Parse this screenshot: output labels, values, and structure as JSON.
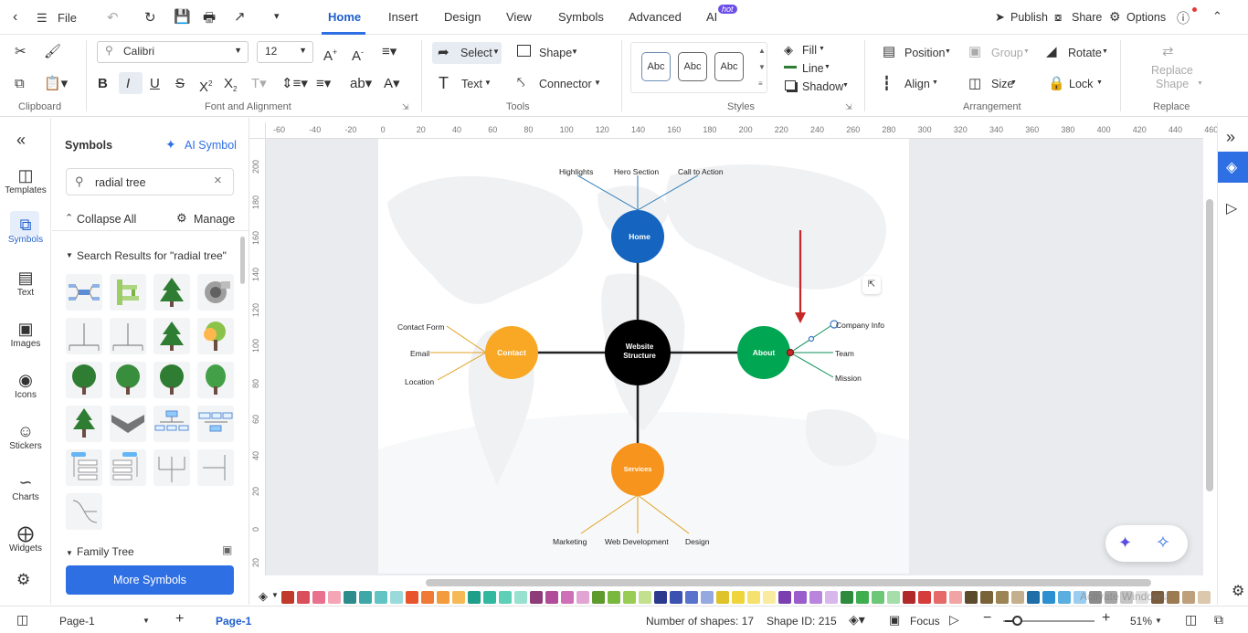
{
  "topbar": {
    "file": "File",
    "tabs": [
      "Home",
      "Insert",
      "Design",
      "View",
      "Symbols",
      "Advanced",
      "AI"
    ],
    "ai_badge": "hot",
    "publish": "Publish",
    "share": "Share",
    "options": "Options"
  },
  "ribbon": {
    "clipboard_label": "Clipboard",
    "font_label": "Font and Alignment",
    "tools_label": "Tools",
    "styles_label": "Styles",
    "arrangement_label": "Arrangement",
    "replace_label": "Replace",
    "font_name": "Calibri",
    "font_size": "12",
    "select": "Select",
    "shape": "Shape",
    "text": "Text",
    "connector": "Connector",
    "style_sample": "Abc",
    "fill": "Fill",
    "line": "Line",
    "shadow": "Shadow",
    "position": "Position",
    "group": "Group",
    "rotate": "Rotate",
    "align": "Align",
    "size": "Size",
    "lock": "Lock",
    "replace_shape_1": "Replace",
    "replace_shape_2": "Shape"
  },
  "rail": {
    "items": [
      "Templates",
      "Symbols",
      "Text",
      "Images",
      "Icons",
      "Stickers",
      "Charts",
      "Widgets"
    ]
  },
  "symbols_panel": {
    "title": "Symbols",
    "ai_symbol": "AI Symbol",
    "search_value": "radial tree",
    "collapse_all": "Collapse All",
    "manage": "Manage",
    "results_header": "Search Results for  \"radial tree\"",
    "family_tree": "Family Tree",
    "more_symbols": "More Symbols"
  },
  "ruler": {
    "h": [
      "-60",
      "-40",
      "-20",
      "0",
      "20",
      "40",
      "60",
      "80",
      "100",
      "120",
      "140",
      "160",
      "180",
      "200",
      "220",
      "240",
      "260",
      "280",
      "300",
      "320",
      "340",
      "360",
      "380",
      "400",
      "420",
      "440",
      "460"
    ],
    "v": [
      "200",
      "180",
      "160",
      "140",
      "120",
      "100",
      "80",
      "60",
      "40",
      "20",
      "0",
      "20"
    ]
  },
  "diagram": {
    "center": "Website Structure",
    "center_l1": "Website",
    "center_l2": "Structure",
    "home": "Home",
    "contact": "Contact",
    "about": "About",
    "services": "Services",
    "home_children": [
      "Highlights",
      "Hero Section",
      "Call to Action"
    ],
    "contact_children": [
      "Contact Form",
      "Email",
      "Location"
    ],
    "about_children": [
      "Company Info",
      "Team",
      "Mission"
    ],
    "services_children": [
      "Marketing",
      "Web Development",
      "Design"
    ],
    "colors": {
      "home": "#1565c0",
      "contact": "#f9a825",
      "about": "#00a651",
      "services": "#f7941d",
      "center": "#000000",
      "line_home": "#2a7ab5",
      "line_contact": "#e0a020",
      "line_about": "#0b8f5a",
      "line_services": "#e0a020",
      "arrow": "#c62828"
    }
  },
  "palette": [
    "#c0392b",
    "#d94f5c",
    "#e8718d",
    "#f4a6b7",
    "#2e8b8b",
    "#3fa7a7",
    "#62c4c4",
    "#9bdada",
    "#e8552c",
    "#f07a35",
    "#f39c3e",
    "#f7b955",
    "#1f9e89",
    "#33b8a0",
    "#5fcfb7",
    "#98e0cf",
    "#8e3b7a",
    "#b04c98",
    "#cf6fb8",
    "#e2a5d3",
    "#5e9a2c",
    "#78b83c",
    "#99cc55",
    "#c2e08e",
    "#2b3a8c",
    "#3c52b0",
    "#5a73cc",
    "#96a8e0",
    "#e0c22a",
    "#f0d43c",
    "#f5e16e",
    "#f9ec9f",
    "#7b3fb0",
    "#9b5ccc",
    "#b985dc",
    "#d8b7ec",
    "#2e8b3e",
    "#3fae4f",
    "#6cc777",
    "#a6deaa",
    "#b02a2a",
    "#d63c3c",
    "#e66a6a",
    "#f2a3a3",
    "#5c4a2c",
    "#7a6238",
    "#9c8455",
    "#c4b08e",
    "#1e6fa8",
    "#2c8fd0",
    "#5aaee0",
    "#9acdef",
    "#8c8c8c",
    "#a6a6a6",
    "#c4c4c4",
    "#e0e0e0",
    "#7a5c3c",
    "#9c7a52",
    "#bfa07c",
    "#dcc8ad"
  ],
  "status": {
    "page_select": "Page-1",
    "page_tab": "Page-1",
    "shapes": "Number of shapes: 17",
    "shape_id": "Shape ID: 215",
    "focus": "Focus",
    "zoom": "51%",
    "watermark": "Activate Windows"
  }
}
